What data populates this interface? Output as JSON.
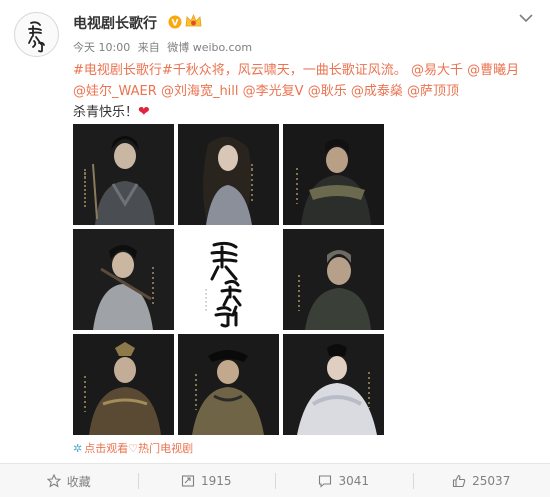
{
  "author": {
    "name": "电视剧长歌行",
    "avatar_text": "长歌行",
    "verified": true,
    "vip_badge": true
  },
  "meta": {
    "time": "今天 10:00",
    "source_prefix": "来自",
    "source": "微博 weibo.com"
  },
  "post": {
    "tag": "#电视剧长歌行#",
    "body": "千秋众将，风云啸天，一曲长歌证风流。",
    "mentions": [
      "@易大千",
      "@曹曦月",
      "@娃尔_WAER",
      "@刘海宽_hill",
      "@李光复V",
      "@耿乐",
      "@成泰燊",
      "@萨顶顶"
    ],
    "closing": "杀青快乐！",
    "heart": "❤"
  },
  "images": [
    {
      "name": "poster-1",
      "kind": "portrait"
    },
    {
      "name": "poster-2",
      "kind": "portrait"
    },
    {
      "name": "poster-3",
      "kind": "portrait"
    },
    {
      "name": "poster-4",
      "kind": "portrait"
    },
    {
      "name": "poster-title",
      "kind": "title",
      "title_text": "長歌行"
    },
    {
      "name": "poster-6",
      "kind": "portrait"
    },
    {
      "name": "poster-7",
      "kind": "portrait"
    },
    {
      "name": "poster-8",
      "kind": "portrait"
    },
    {
      "name": "poster-9",
      "kind": "portrait"
    }
  ],
  "footer_link": {
    "icon": "✲",
    "text": "点击观看♡热门电视剧"
  },
  "actions": {
    "favorite": {
      "label": "收藏",
      "icon": "star-icon"
    },
    "repost": {
      "label": "1915",
      "icon": "repost-icon"
    },
    "comment": {
      "label": "3041",
      "icon": "comment-icon"
    },
    "like": {
      "label": "25037",
      "icon": "thumb-up-icon"
    }
  },
  "colors": {
    "link": "#eb7350",
    "muted": "#808080",
    "heart": "#e0243d",
    "verify": "#f9a80f"
  }
}
